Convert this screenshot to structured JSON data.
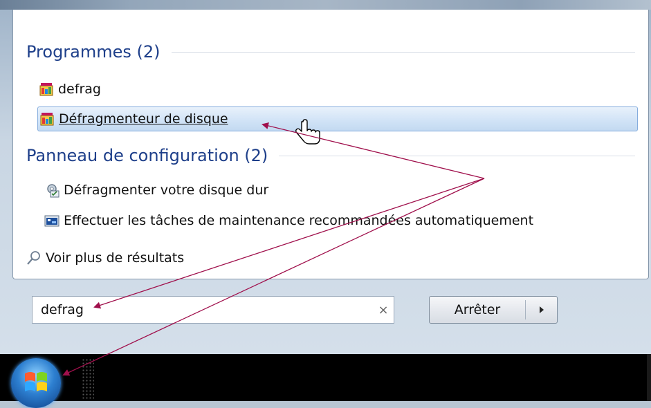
{
  "sections": {
    "programs": {
      "header": "Programmes (2)",
      "items": [
        {
          "label": "defrag",
          "icon": "defrag-program-icon"
        },
        {
          "label": "Défragmenteur de disque",
          "icon": "defrag-program-icon",
          "selected": true
        }
      ]
    },
    "control_panel": {
      "header": "Panneau de configuration (2)",
      "items": [
        {
          "label": "Défragmenter votre disque dur",
          "icon": "defrag-settings-icon"
        },
        {
          "label": "Effectuer les tâches de maintenance recommandées automatiquement",
          "icon": "maintenance-icon"
        }
      ]
    }
  },
  "more_results": {
    "label": "Voir plus de résultats",
    "icon": "search-icon"
  },
  "search": {
    "value": "defrag",
    "clear_glyph": "×"
  },
  "stop_button": {
    "label": "Arrêter",
    "arrow": "▸"
  },
  "colors": {
    "header_text": "#1e3f8a",
    "selection_border": "#84acdd",
    "annotation_arrow": "#a0104c"
  }
}
